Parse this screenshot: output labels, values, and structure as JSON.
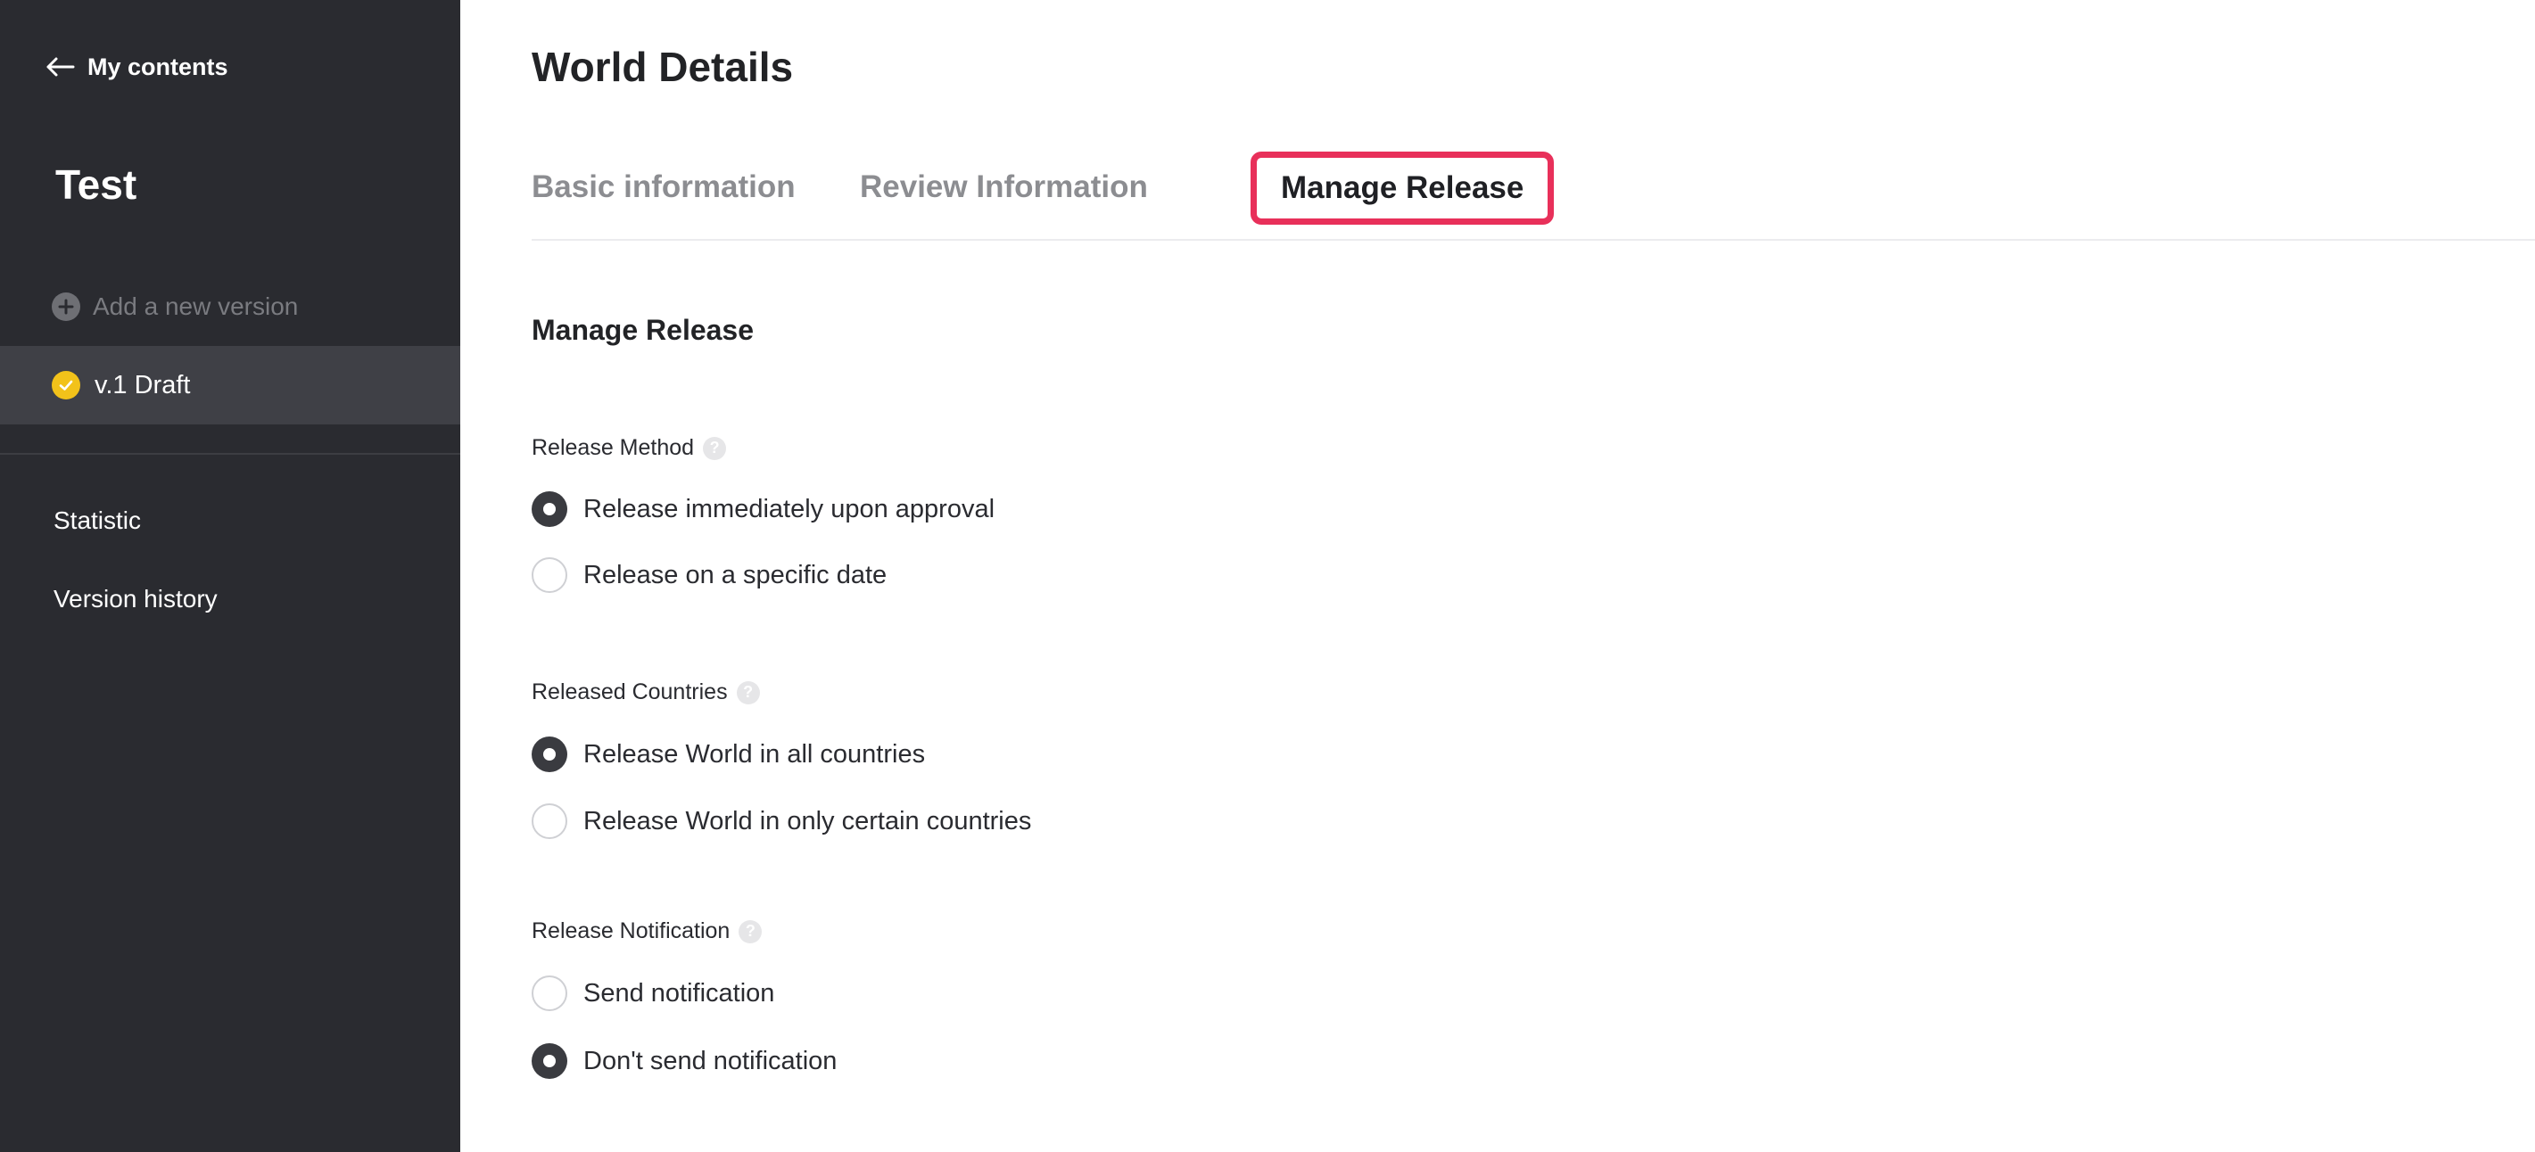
{
  "sidebar": {
    "back_label": "My contents",
    "project_title": "Test",
    "add_version_label": "Add a new version",
    "current_version_label": "v.1 Draft",
    "links": {
      "statistic": "Statistic",
      "version_history": "Version history"
    }
  },
  "main": {
    "page_title": "World Details",
    "tabs": {
      "basic": "Basic information",
      "review": "Review Information",
      "manage": "Manage Release"
    },
    "section_title": "Manage Release",
    "release_method": {
      "label": "Release Method",
      "options": {
        "immediate": "Release immediately upon approval",
        "specific_date": "Release on a specific date"
      },
      "selected": "immediate"
    },
    "released_countries": {
      "label": "Released Countries",
      "options": {
        "all": "Release World in all countries",
        "certain": "Release World in only certain countries"
      },
      "selected": "all"
    },
    "release_notification": {
      "label": "Release Notification",
      "options": {
        "send": "Send notification",
        "dont_send": "Don't send notification"
      },
      "selected": "dont_send"
    }
  },
  "colors": {
    "sidebar_bg": "#2a2b30",
    "active_version_bg": "#3f4046",
    "draft_status": "#f2c21a",
    "highlight_border": "#e8305a"
  },
  "icons": {
    "back": "arrow-left-icon",
    "add": "plus-circle-icon",
    "draft": "check-circle-icon",
    "help": "question-icon"
  }
}
